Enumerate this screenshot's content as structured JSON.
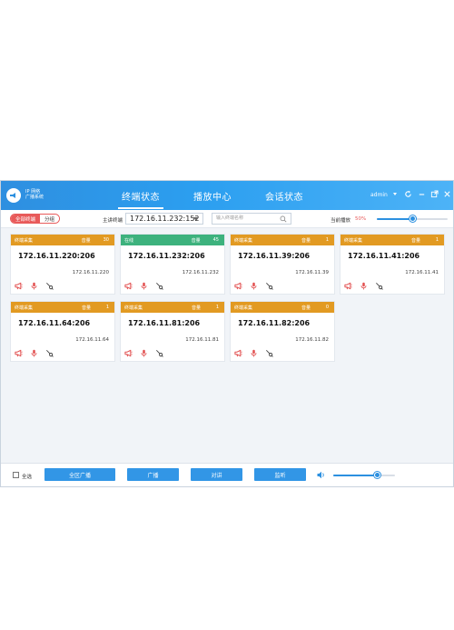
{
  "app": {
    "logo_line1": "IP 网络",
    "logo_line2": "广播系统",
    "tabs": [
      "终端状态",
      "播放中心",
      "会话状态"
    ],
    "active_tab": 0,
    "user": "admin"
  },
  "toolbar": {
    "seg_all": "全部终端",
    "seg_group": "分组",
    "main_terminal_label": "主讲终端",
    "main_terminal_value": "172.16.11.232:152",
    "search_placeholder": "输入终端名称",
    "current_play_label": "当前播放",
    "volume_percent_text": "50%",
    "volume_level": 0.5
  },
  "cards": [
    {
      "status": "终端采集",
      "vol_label": "音量",
      "vol": "30",
      "ip": "172.16.11.220:206",
      "sub": "172.16.11.220",
      "color": "#e29a22"
    },
    {
      "status": "在线",
      "vol_label": "音量",
      "vol": "45",
      "ip": "172.16.11.232:206",
      "sub": "172.16.11.232",
      "color": "#3db27d"
    },
    {
      "status": "终端采集",
      "vol_label": "音量",
      "vol": "1",
      "ip": "172.16.11.39:206",
      "sub": "172.16.11.39",
      "color": "#e29a22"
    },
    {
      "status": "终端采集",
      "vol_label": "音量",
      "vol": "1",
      "ip": "172.16.11.41:206",
      "sub": "172.16.11.41",
      "color": "#e29a22"
    },
    {
      "status": "终端采集",
      "vol_label": "音量",
      "vol": "1",
      "ip": "172.16.11.64:206",
      "sub": "172.16.11.64",
      "color": "#e29a22"
    },
    {
      "status": "终端采集",
      "vol_label": "音量",
      "vol": "1",
      "ip": "172.16.11.81:206",
      "sub": "172.16.11.81",
      "color": "#e29a22"
    },
    {
      "status": "终端采集",
      "vol_label": "音量",
      "vol": "0",
      "ip": "172.16.11.82:206",
      "sub": "172.16.11.82",
      "color": "#e29a22"
    }
  ],
  "card_icons": [
    "megaphone-icon",
    "microphone-icon",
    "monitor-probe-icon"
  ],
  "footer": {
    "select_all": "全选",
    "buttons": [
      "全区广播",
      "广播",
      "对讲",
      "监听"
    ],
    "volume_level": 0.72
  },
  "colors": {
    "accent": "#2c90e0",
    "alert": "#e85a5a",
    "collecting": "#e29a22",
    "online": "#3db27d"
  }
}
